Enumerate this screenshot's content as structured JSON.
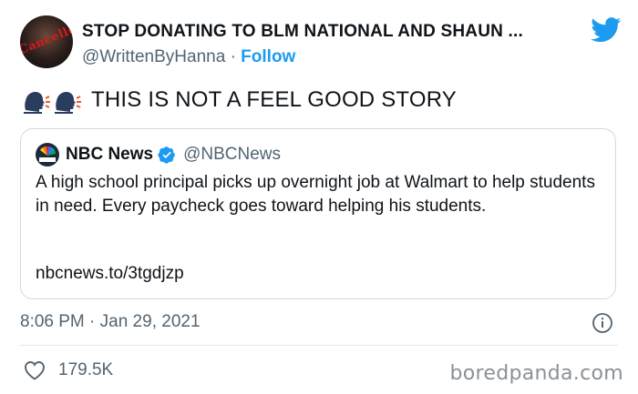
{
  "author": {
    "display_name": "STOP DONATING TO BLM NATIONAL AND SHAUN ...",
    "handle": "@WrittenByHanna",
    "separator": "·",
    "follow_label": "Follow",
    "avatar_stamp_text": "Cancelled"
  },
  "tweet": {
    "emoji": [
      "speaking-head",
      "speaking-head"
    ],
    "text": "THIS IS NOT A FEEL GOOD STORY"
  },
  "quoted_tweet": {
    "name": "NBC News",
    "handle": "@NBCNews",
    "verified": true,
    "body": "A high school principal picks up overnight job at Walmart to help students in need. Every paycheck goes toward helping his students.",
    "link": "nbcnews.to/3tgdjzp"
  },
  "meta": {
    "timestamp": "8:06 PM · Jan 29, 2021"
  },
  "engagement": {
    "likes": "179.5K"
  },
  "watermark": "boredpanda.com",
  "colors": {
    "accent": "#1d9bf0",
    "muted": "#536471",
    "border": "#cfd9de"
  }
}
